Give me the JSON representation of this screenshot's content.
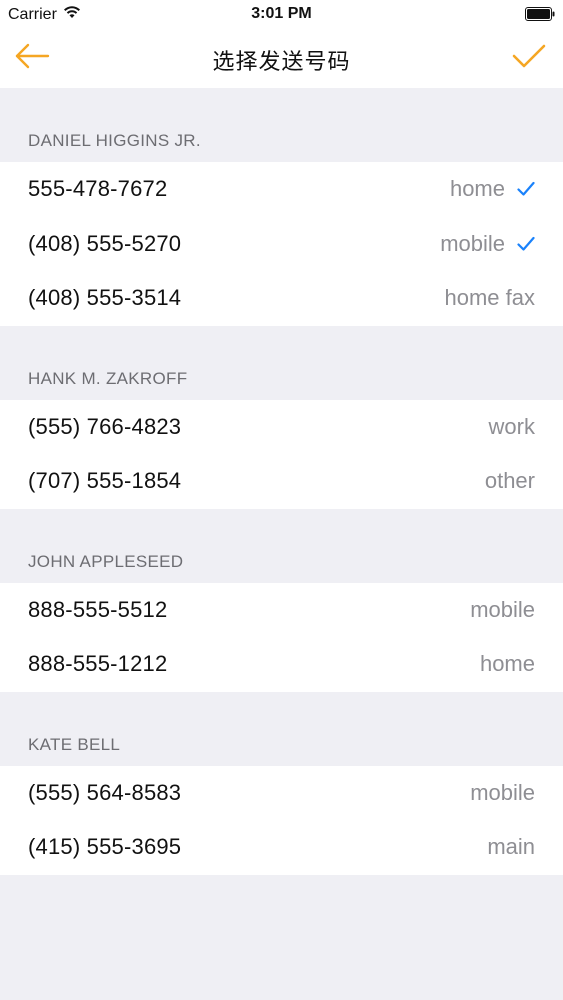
{
  "status_bar": {
    "carrier": "Carrier",
    "time": "3:01 PM",
    "wifi_icon": "wifi-icon",
    "battery_icon": "battery-full-icon"
  },
  "nav": {
    "title": "选择发送号码",
    "back_icon": "arrow-left-icon",
    "done_icon": "checkmark-icon",
    "accent_color": "#f5a623"
  },
  "sections": [
    {
      "name": "DANIEL HIGGINS JR.",
      "rows": [
        {
          "number": "555-478-7672",
          "label": "home",
          "checked": true
        },
        {
          "number": "(408) 555-5270",
          "label": "mobile",
          "checked": true
        },
        {
          "number": "(408) 555-3514",
          "label": "home fax",
          "checked": false
        }
      ]
    },
    {
      "name": "HANK M. ZAKROFF",
      "rows": [
        {
          "number": "(555) 766-4823",
          "label": "work",
          "checked": false
        },
        {
          "number": "(707) 555-1854",
          "label": "other",
          "checked": false
        }
      ]
    },
    {
      "name": "JOHN APPLESEED",
      "rows": [
        {
          "number": "888-555-5512",
          "label": "mobile",
          "checked": false
        },
        {
          "number": "888-555-1212",
          "label": "home",
          "checked": false
        }
      ]
    },
    {
      "name": "KATE BELL",
      "rows": [
        {
          "number": "(555) 564-8583",
          "label": "mobile",
          "checked": false
        },
        {
          "number": "(415) 555-3695",
          "label": "main",
          "checked": false
        }
      ]
    }
  ],
  "colors": {
    "check": "#1a82fb",
    "background": "#efeff4",
    "label_gray": "#8e8e93"
  }
}
